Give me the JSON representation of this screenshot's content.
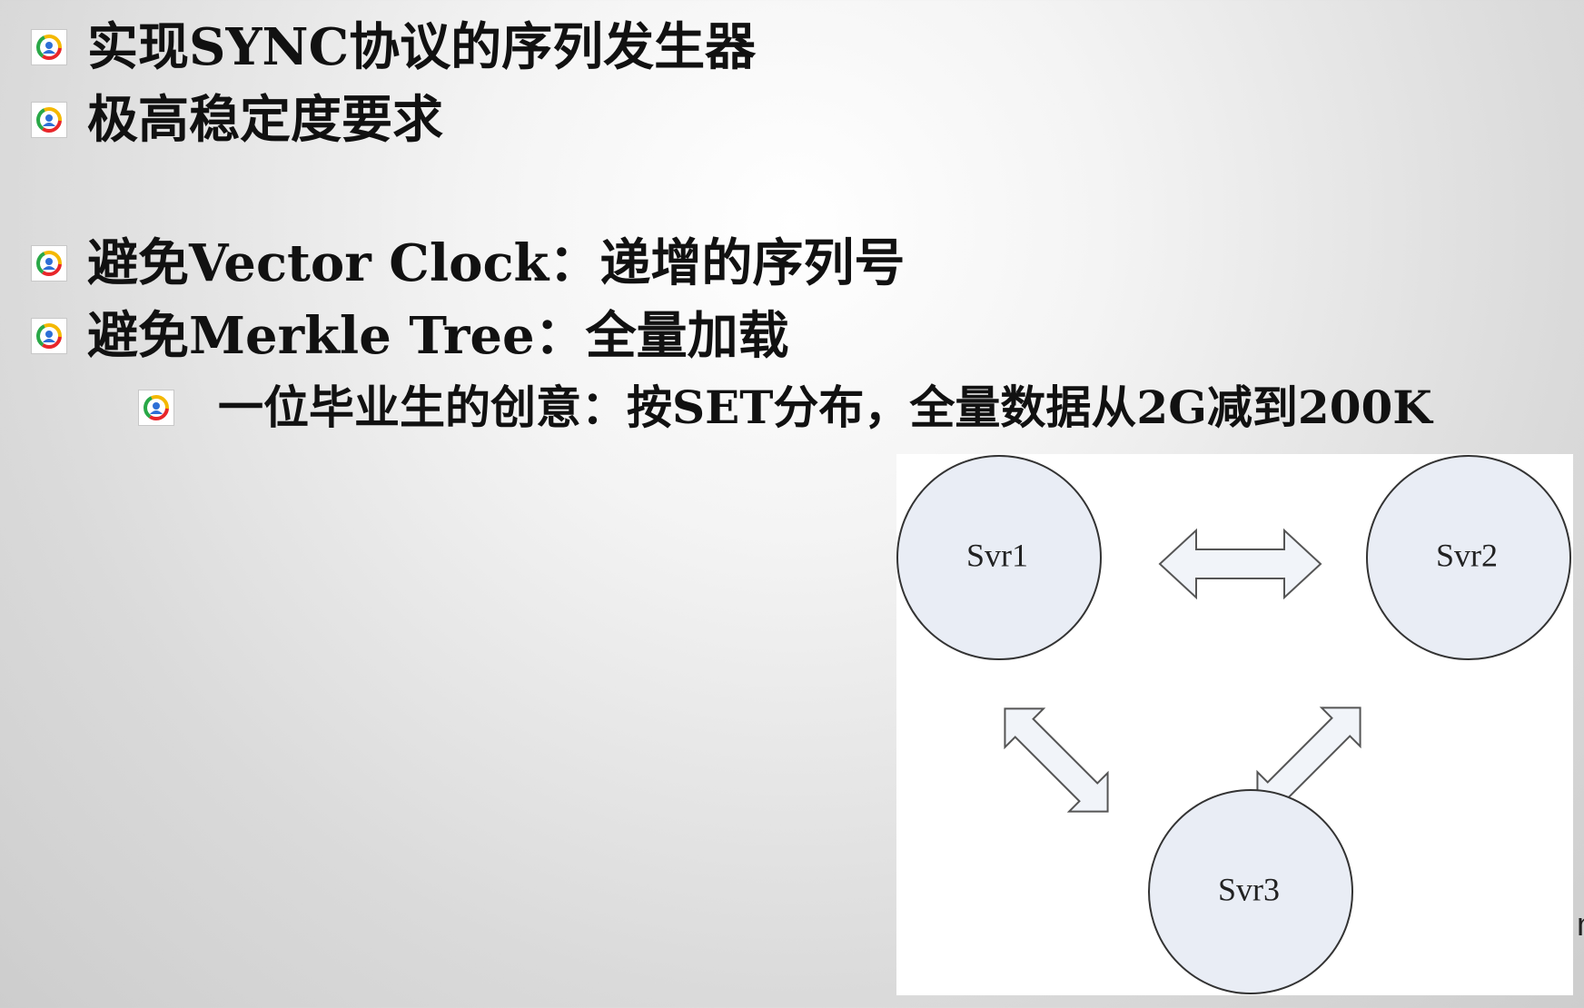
{
  "bullets": [
    {
      "text": "实现SYNC协议的序列发生器",
      "level": 1
    },
    {
      "text": "极高稳定度要求",
      "level": 1
    },
    {
      "text": "避免Vector Clock：递增的序列号",
      "level": 1
    },
    {
      "text": "避免Merkle Tree：全量加载",
      "level": 1
    },
    {
      "text": "一位毕业生的创意：按SET分布，全量数据从2G减到200K",
      "level": 2
    }
  ],
  "diagram": {
    "nodes": [
      {
        "label": "Svr1"
      },
      {
        "label": "Svr2"
      },
      {
        "label": "Svr3"
      }
    ],
    "edges": [
      {
        "from": "Svr1",
        "to": "Svr2",
        "type": "bidirectional"
      },
      {
        "from": "Svr1",
        "to": "Svr3",
        "type": "bidirectional"
      },
      {
        "from": "Svr2",
        "to": "Svr3",
        "type": "bidirectional"
      }
    ]
  },
  "edge_glyph": "n",
  "colors": {
    "node_fill": "#e9edf5",
    "arrow_fill": "#f1f4f9",
    "text": "#111111"
  }
}
